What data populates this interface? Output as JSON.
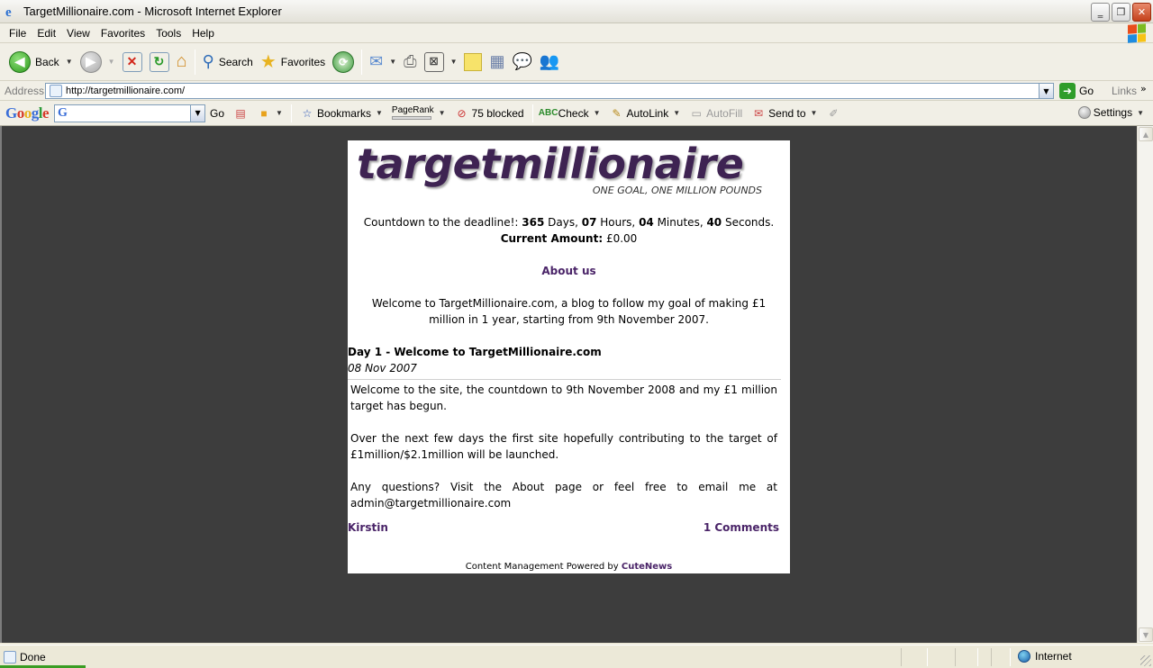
{
  "window": {
    "title": "TargetMillionaire.com - Microsoft Internet Explorer",
    "minimize": "‗",
    "restore": "❐",
    "close": "✕"
  },
  "menu": [
    "File",
    "Edit",
    "View",
    "Favorites",
    "Tools",
    "Help"
  ],
  "toolbar": {
    "back": "Back",
    "search": "Search",
    "favorites": "Favorites"
  },
  "address": {
    "label": "Address",
    "url": "http://targetmillionaire.com/",
    "go": "Go",
    "links": "Links"
  },
  "google_toolbar": {
    "logo_letters": [
      {
        "ch": "G",
        "color": "#3a6ed8"
      },
      {
        "ch": "o",
        "color": "#d63a2a"
      },
      {
        "ch": "o",
        "color": "#e8b321"
      },
      {
        "ch": "g",
        "color": "#3a6ed8"
      },
      {
        "ch": "l",
        "color": "#2e9b3a"
      },
      {
        "ch": "e",
        "color": "#d63a2a"
      }
    ],
    "search_value": "",
    "go": "Go",
    "bookmarks": "Bookmarks",
    "pagerank": "PageRank",
    "blocked": "75 blocked",
    "check": "Check",
    "autolink": "AutoLink",
    "autofill": "AutoFill",
    "send_to": "Send to",
    "settings": "Settings"
  },
  "page": {
    "logo_text": "targetmillionaire",
    "tagline": "ONE GOAL, ONE MILLION POUNDS",
    "countdown": {
      "prefix": "Countdown to the deadline!: ",
      "days": "365",
      "days_label": " Days, ",
      "hours": "07",
      "hours_label": " Hours, ",
      "minutes": "04",
      "minutes_label": " Minutes, ",
      "seconds": "40",
      "seconds_label": " Seconds."
    },
    "amount_label": "Current Amount:",
    "amount_value": " £0.00",
    "about_link": "About us",
    "welcome": "Welcome to TargetMillionaire.com, a blog to follow my goal of making £1 million in 1 year, starting from 9th November 2007.",
    "post": {
      "title": "Day 1 - Welcome to TargetMillionaire.com",
      "date": "08 Nov 2007",
      "paragraphs": [
        "Welcome to the site, the countdown to 9th November 2008 and my £1 million target has begun.",
        "Over the next few days the first site hopefully contributing to the target of £1million/$2.1million will be launched.",
        "Any questions? Visit the About page or feel free to email me at admin@targetmillionaire.com"
      ],
      "author": "Kirstin",
      "comments": "1 Comments"
    },
    "powered_prefix": "Content Management Powered by ",
    "powered_link": "CuteNews"
  },
  "status": {
    "text": "Done",
    "zone": "Internet"
  },
  "colors": {
    "brand_purple": "#3e2352",
    "link_purple": "#4a2468",
    "page_background": "#3d3d3d"
  }
}
